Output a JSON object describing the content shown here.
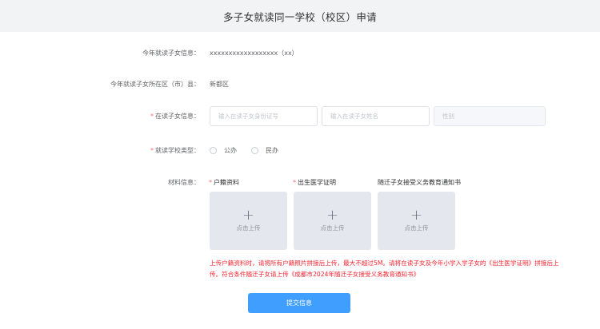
{
  "header": {
    "title": "多子女就读同一学校（校区）申请"
  },
  "fields": {
    "child_info": {
      "label": "今年就读子女信息：",
      "value": "xxxxxxxxxxxxxxxxxx（xx）"
    },
    "child_district": {
      "label": "今年就读子女所在区（市）县：",
      "value": "新都区"
    },
    "student_info": {
      "label": "在读子女信息：",
      "id_placeholder": "输入在读子女身份证号",
      "name_placeholder": "输入在读子女姓名",
      "gender_placeholder": "性别"
    },
    "school_type": {
      "label": "就读学校类型：",
      "options": [
        "公办",
        "民办"
      ]
    },
    "materials": {
      "label": "材料信息：",
      "uploads": [
        {
          "label": "户籍资料",
          "required": true,
          "button_text": "点击上传"
        },
        {
          "label": "出生医学证明",
          "required": true,
          "button_text": "点击上传"
        },
        {
          "label": "随迁子女接受义务教育通知书",
          "required": false,
          "button_text": "点击上传"
        }
      ]
    }
  },
  "notice": "上传户籍资料时，请将所有户籍照片拼接后上传，最大不超过5M。请将在读子女及今年小学入学子女的《出生医学证明》拼接后上传。符合条件随迁子女请上传《成都市2024年随迁子女接受义务教育通知书》",
  "submit_label": "提交信息",
  "colors": {
    "primary": "#409eff",
    "required": "#f56c6c",
    "notice": "#f5222d",
    "header_bg": "#f2f3f5"
  },
  "required_mark": "*"
}
